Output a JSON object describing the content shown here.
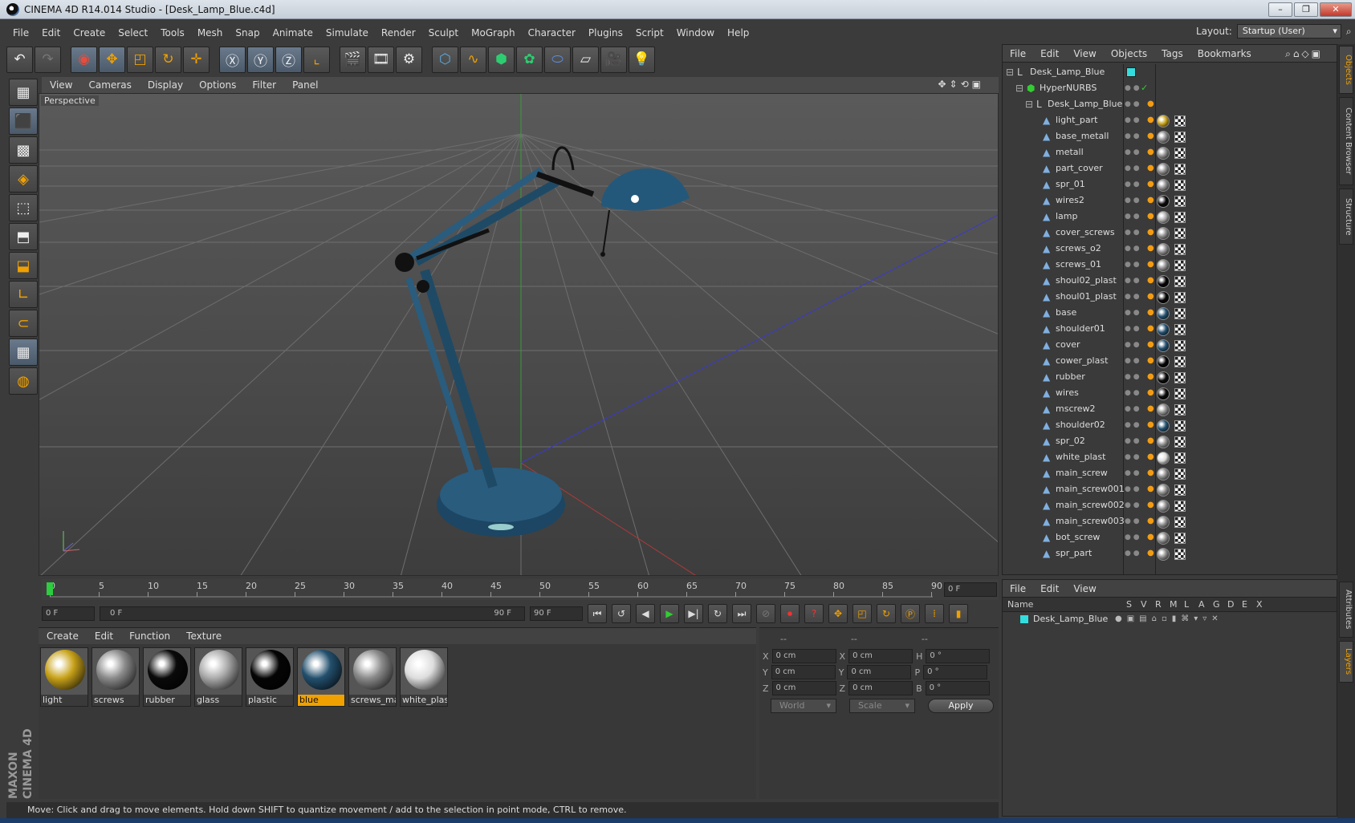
{
  "window": {
    "title": "CINEMA 4D R14.014 Studio - [Desk_Lamp_Blue.c4d]",
    "min": "–",
    "max": "❐",
    "close": "✕"
  },
  "menu": [
    "File",
    "Edit",
    "Create",
    "Select",
    "Tools",
    "Mesh",
    "Snap",
    "Animate",
    "Simulate",
    "Render",
    "Sculpt",
    "MoGraph",
    "Character",
    "Plugins",
    "Script",
    "Window",
    "Help"
  ],
  "layout": {
    "label": "Layout:",
    "value": "Startup (User)"
  },
  "viewport": {
    "menu": [
      "View",
      "Cameras",
      "Display",
      "Options",
      "Filter",
      "Panel"
    ],
    "name": "Perspective"
  },
  "timeline": {
    "ticks": [
      "0",
      "5",
      "10",
      "15",
      "20",
      "25",
      "30",
      "35",
      "40",
      "45",
      "50",
      "55",
      "60",
      "65",
      "70",
      "75",
      "80",
      "85",
      "90"
    ],
    "current_frame": "0 F",
    "start": "0 F",
    "slider_start": "0 F",
    "slider_end": "90 F",
    "end": "90 F"
  },
  "materials": {
    "menu": [
      "Create",
      "Edit",
      "Function",
      "Texture"
    ],
    "items": [
      {
        "name": "light",
        "color": "#c8a21a"
      },
      {
        "name": "screws",
        "color": "#8a8a8a"
      },
      {
        "name": "rubber",
        "color": "#0a0a0a"
      },
      {
        "name": "glass",
        "color": "#aaaaaa"
      },
      {
        "name": "plastic",
        "color": "#050505"
      },
      {
        "name": "blue",
        "color": "#23506e",
        "selected": true
      },
      {
        "name": "screws_mai",
        "color": "#8a8a8a"
      },
      {
        "name": "white_plas",
        "color": "#dddddd"
      }
    ]
  },
  "coords": {
    "headers": [
      "--",
      "--",
      "--"
    ],
    "rows": [
      {
        "a": "X",
        "a_val": "0 cm",
        "b": "X",
        "b_val": "0 cm",
        "c": "H",
        "c_val": "0 °"
      },
      {
        "a": "Y",
        "a_val": "0 cm",
        "b": "Y",
        "b_val": "0 cm",
        "c": "P",
        "c_val": "0 °"
      },
      {
        "a": "Z",
        "a_val": "0 cm",
        "b": "Z",
        "b_val": "0 cm",
        "c": "B",
        "c_val": "0 °"
      }
    ],
    "mode": "World",
    "transform": "Scale",
    "apply": "Apply"
  },
  "objects": {
    "menu": [
      "File",
      "Edit",
      "View",
      "Objects",
      "Tags",
      "Bookmarks"
    ],
    "root": "Desk_Lamp_Blue",
    "nurbs": "HyperNURBS",
    "group": "Desk_Lamp_Blue",
    "items": [
      {
        "name": "light_part",
        "mat": "#c8a21a"
      },
      {
        "name": "base_metall",
        "mat": "#8a8a8a"
      },
      {
        "name": "metall",
        "mat": "#8a8a8a"
      },
      {
        "name": "part_cover",
        "mat": "#8a8a8a"
      },
      {
        "name": "spr_01",
        "mat": "#8a8a8a"
      },
      {
        "name": "wires2",
        "mat": "#0a0a0a"
      },
      {
        "name": "lamp",
        "mat": "#aaaaaa"
      },
      {
        "name": "cover_screws",
        "mat": "#8a8a8a"
      },
      {
        "name": "screws_o2",
        "mat": "#8a8a8a"
      },
      {
        "name": "screws_01",
        "mat": "#8a8a8a"
      },
      {
        "name": "shoul02_plast",
        "mat": "#050505"
      },
      {
        "name": "shoul01_plast",
        "mat": "#050505"
      },
      {
        "name": "base",
        "mat": "#23506e"
      },
      {
        "name": "shoulder01",
        "mat": "#23506e"
      },
      {
        "name": "cover",
        "mat": "#23506e"
      },
      {
        "name": "cower_plast",
        "mat": "#050505"
      },
      {
        "name": "rubber",
        "mat": "#0a0a0a"
      },
      {
        "name": "wires",
        "mat": "#0a0a0a"
      },
      {
        "name": "mscrew2",
        "mat": "#8a8a8a"
      },
      {
        "name": "shoulder02",
        "mat": "#23506e"
      },
      {
        "name": "spr_02",
        "mat": "#8a8a8a"
      },
      {
        "name": "white_plast",
        "mat": "#dddddd"
      },
      {
        "name": "main_screw",
        "mat": "#8a8a8a"
      },
      {
        "name": "main_screw001",
        "mat": "#8a8a8a"
      },
      {
        "name": "main_screw002",
        "mat": "#8a8a8a"
      },
      {
        "name": "main_screw003",
        "mat": "#8a8a8a"
      },
      {
        "name": "bot_screw",
        "mat": "#8a8a8a"
      },
      {
        "name": "spr_part",
        "mat": "#8a8a8a"
      }
    ]
  },
  "layers": {
    "menu": [
      "File",
      "Edit",
      "View"
    ],
    "headers": [
      "Name",
      "S",
      "V",
      "R",
      "M",
      "L",
      "A",
      "G",
      "D",
      "E",
      "X"
    ],
    "row": "Desk_Lamp_Blue"
  },
  "sidetabs": [
    "Objects",
    "Content Browser",
    "Structure",
    "Attributes",
    "Layers"
  ],
  "status": "Move: Click and drag to move elements. Hold down SHIFT to quantize movement / add to the selection in point mode, CTRL to remove.",
  "brand": "MAXON CINEMA 4D",
  "colors": {
    "accent": "#f0a000",
    "lamp_blue": "#1f4a66"
  }
}
